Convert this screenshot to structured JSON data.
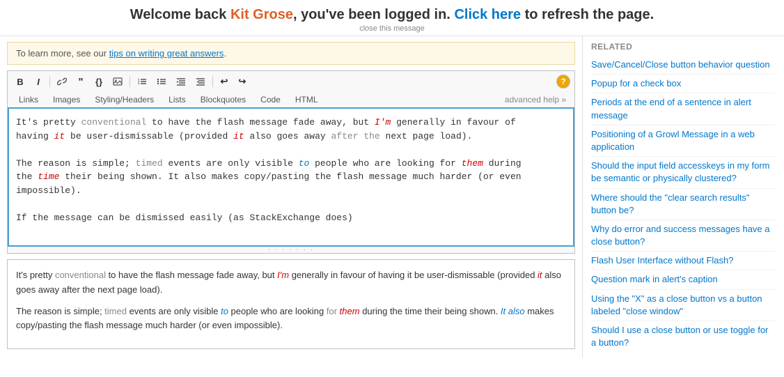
{
  "notification": {
    "prefix": "Welcome back ",
    "name": "Kit Grose",
    "middle": ", you've been logged in. ",
    "cta": "Click here",
    "suffix": " to refresh the page.",
    "close": "close this message"
  },
  "infobox": {
    "text": "To learn more, see our ",
    "link_text": "tips on writing great answers",
    "link_suffix": "."
  },
  "toolbar": {
    "bold": "B",
    "italic": "I",
    "link": "🔗",
    "blockquote": "\"",
    "code": "{}",
    "image": "🖼",
    "ordered_list": "ol",
    "unordered_list": "ul",
    "indent": "→",
    "outdent": "←",
    "undo": "↩",
    "redo": "↪",
    "help": "?"
  },
  "tabs": {
    "items": [
      "Links",
      "Images",
      "Styling/Headers",
      "Lists",
      "Blockquotes",
      "Code",
      "HTML"
    ],
    "advanced_help": "advanced help »"
  },
  "editor": {
    "content_line1": "It's pretty conventional to have the flash message fade away, but I'm generally in favour of",
    "content_line2": "having it be user-dismissable (provided it also goes away after the next page load).",
    "content_line3": "",
    "content_line4": "The reason is simple; timed events are only visible to people who are looking for them during",
    "content_line5": "the time their being shown. It also makes copy/pasting the flash message much harder (or even",
    "content_line6": "impossible).",
    "content_line7": "",
    "content_line8": "If the message can be dismissed easily (as StackExchange does)"
  },
  "preview": {
    "para1_a": "It's pretty ",
    "para1_conventional": "conventional",
    "para1_b": " to have the flash message fade away, but ",
    "para1_im": "I'm",
    "para1_c": " generally in favour of having it be user-dismissable (provided ",
    "para1_it": "it",
    "para1_d": " also goes away after the next page load).",
    "para2_a": "The reason is simple; ",
    "para2_timed": "timed",
    "para2_b": " events are only visible ",
    "para2_to": "to",
    "para2_c": " people who are looking ",
    "para2_for": "for",
    "para2_d": " ",
    "para2_them": "them",
    "para2_e": " during the time their being shown. ",
    "para2_also": "It also",
    "para2_f": " makes copy/pasting the flash message much harder (or even impossible)."
  },
  "sidebar": {
    "links": [
      "Save/Cancel/Close button behavior question",
      "Popup for a check box",
      "Periods at the end of a sentence in alert message",
      "Positioning of a Growl Message in a web application",
      "Should the input field accesskeys in my form be semantic or physically clustered?",
      "Where should the \"clear search results\" button be?",
      "Why do error and success messages have a close button?",
      "Flash User Interface without Flash?",
      "Question mark in alert's caption",
      "Using the \"X\" as a close button vs a button labeled \"close window\"",
      "Should I use a close button or use toggle for a button?"
    ]
  }
}
